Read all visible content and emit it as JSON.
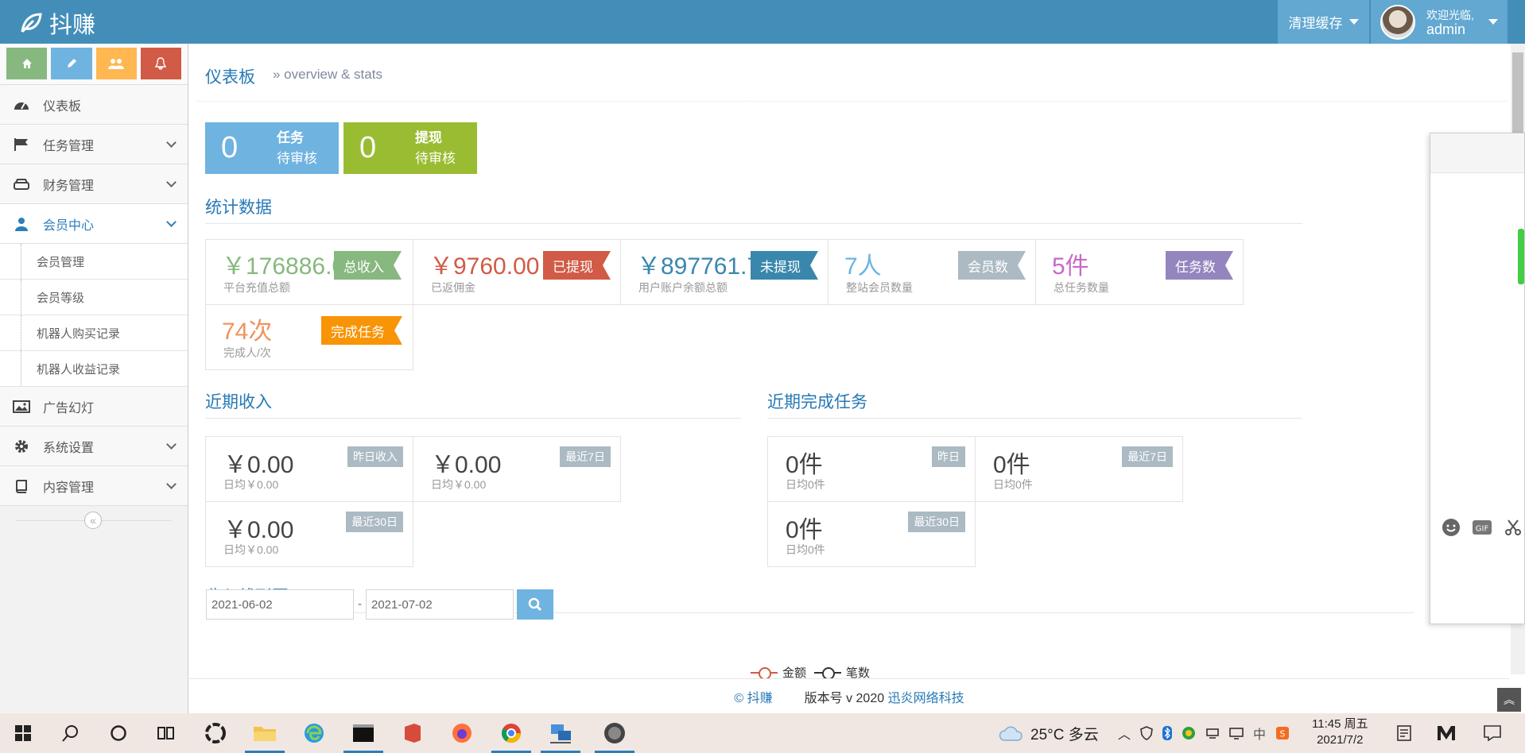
{
  "navbar": {
    "brand": "抖赚",
    "clear_cache": "清理缓存",
    "welcome": "欢迎光临,",
    "username": "admin"
  },
  "sidebar": {
    "items": [
      {
        "label": "仪表板",
        "icon": "dashboard-icon"
      },
      {
        "label": "任务管理",
        "icon": "flag-icon"
      },
      {
        "label": "财务管理",
        "icon": "hdd-icon"
      },
      {
        "label": "会员中心",
        "icon": "user-icon"
      },
      {
        "label": "广告幻灯",
        "icon": "picture-icon"
      },
      {
        "label": "系统设置",
        "icon": "gear-icon"
      },
      {
        "label": "内容管理",
        "icon": "book-icon"
      }
    ],
    "sub_items": [
      "会员管理",
      "会员等级",
      "机器人购买记录",
      "机器人收益记录"
    ]
  },
  "header": {
    "title": "仪表板",
    "subtitle": "» overview & stats"
  },
  "pending": {
    "task": {
      "count": "0",
      "label": "任务",
      "sub": "待审核",
      "color": "#6fb3e0"
    },
    "withdraw": {
      "count": "0",
      "label": "提现",
      "sub": "待审核",
      "color": "#9abc32"
    }
  },
  "stats": {
    "title": "统计数据",
    "items": [
      {
        "value": "￥176886.00",
        "desc": "平台充值总额",
        "badge": "总收入",
        "color": "#87b87f"
      },
      {
        "value": "￥9760.00",
        "desc": "已返佣金",
        "badge": "已提现",
        "color": "#d15b47"
      },
      {
        "value": "￥897761.75",
        "desc": "用户账户余额总额",
        "badge": "未提现",
        "color": "#3a87ad"
      },
      {
        "value": "7人",
        "desc": "整站会员数量",
        "badge": "会员数",
        "color": "#abbac3"
      },
      {
        "value": "5件",
        "desc": "总任务数量",
        "badge": "任务数",
        "color": "#9585bf"
      },
      {
        "value": "74次",
        "desc": "完成人/次",
        "badge": "完成任务",
        "color": "#f89406"
      }
    ]
  },
  "income": {
    "title": "近期收入",
    "items": [
      {
        "value": "￥0.00",
        "desc": "日均￥0.00",
        "tag": "昨日收入"
      },
      {
        "value": "￥0.00",
        "desc": "日均￥0.00",
        "tag": "最近7日"
      },
      {
        "value": "￥0.00",
        "desc": "日均￥0.00",
        "tag": "最近30日"
      }
    ]
  },
  "tasks": {
    "title": "近期完成任务",
    "items": [
      {
        "value": "0件",
        "desc": "日均0件",
        "tag": "昨日"
      },
      {
        "value": "0件",
        "desc": "日均0件",
        "tag": "最近7日"
      },
      {
        "value": "0件",
        "desc": "日均0件",
        "tag": "最近30日"
      }
    ]
  },
  "chart": {
    "title": "收入线形图",
    "start_date": "2021-06-02",
    "end_date": "2021-07-02",
    "separator": "-",
    "legend": [
      {
        "name": "金额",
        "color": "#d15b47"
      },
      {
        "name": "笔数",
        "color": "#333333"
      }
    ]
  },
  "footer": {
    "copyright": "© 抖赚",
    "version_prefix": "版本号 v 2020",
    "company": "迅炎网络科技"
  },
  "taskbar": {
    "weather": "25°C 多云",
    "time": "11:45 周五",
    "date": "2021/7/2"
  }
}
